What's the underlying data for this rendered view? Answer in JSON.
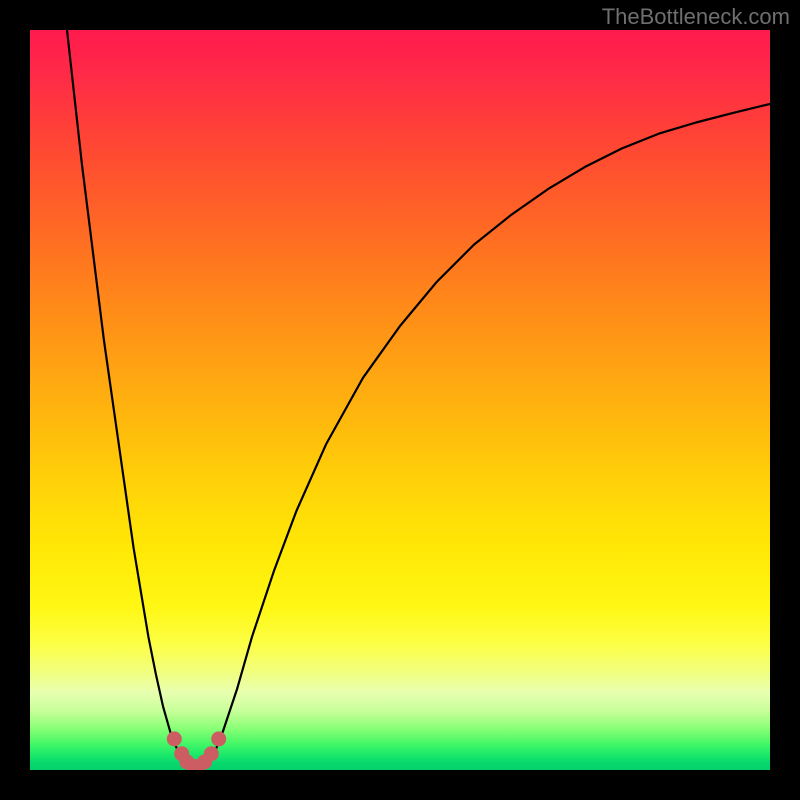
{
  "watermark": "TheBottleneck.com",
  "colors": {
    "frame": "#000000",
    "curve_stroke": "#000000",
    "marker_fill": "#cc5e63",
    "marker_stroke": "#cc5e63"
  },
  "chart_data": {
    "type": "line",
    "title": "",
    "xlabel": "",
    "ylabel": "",
    "xlim": [
      0,
      100
    ],
    "ylim": [
      0,
      100
    ],
    "grid": false,
    "legend": false,
    "series": [
      {
        "name": "bottleneck-curve",
        "x": [
          5,
          6,
          7,
          8,
          9,
          10,
          11,
          12,
          13,
          14,
          15,
          16,
          17,
          18,
          19,
          20,
          21,
          22,
          23,
          24,
          25,
          26,
          28,
          30,
          33,
          36,
          40,
          45,
          50,
          55,
          60,
          65,
          70,
          75,
          80,
          85,
          90,
          95,
          100
        ],
        "y": [
          100,
          91,
          82,
          74,
          66,
          58,
          51,
          44,
          37,
          30,
          24,
          18,
          13,
          8.5,
          5,
          2.5,
          1,
          0.3,
          0.3,
          1,
          2.5,
          5,
          11,
          18,
          27,
          35,
          44,
          53,
          60,
          66,
          71,
          75,
          78.5,
          81.5,
          84,
          86,
          87.5,
          88.8,
          90
        ]
      }
    ],
    "markers": {
      "name": "trough-markers",
      "x": [
        19.5,
        20.5,
        21.2,
        22.0,
        22.8,
        23.6,
        24.5,
        25.5
      ],
      "y": [
        4.2,
        2.2,
        1.1,
        0.5,
        0.5,
        1.1,
        2.2,
        4.2
      ]
    },
    "gradient_stops_pct": [
      0,
      6,
      14,
      22,
      30,
      38,
      46,
      54,
      62,
      70,
      78,
      83,
      86.5,
      89.5,
      92,
      94.5,
      96.5,
      98,
      99,
      100
    ],
    "gradient_colors": [
      "#ff1a4d",
      "#ff2a47",
      "#ff4236",
      "#ff5a2a",
      "#ff7320",
      "#ff8c18",
      "#ffa412",
      "#ffbc0c",
      "#ffd408",
      "#ffe806",
      "#fff714",
      "#fcff46",
      "#f2ff7a",
      "#e8ffb0",
      "#c8ff9a",
      "#86ff74",
      "#42f766",
      "#19e86a",
      "#08d96e",
      "#04d06c"
    ]
  }
}
